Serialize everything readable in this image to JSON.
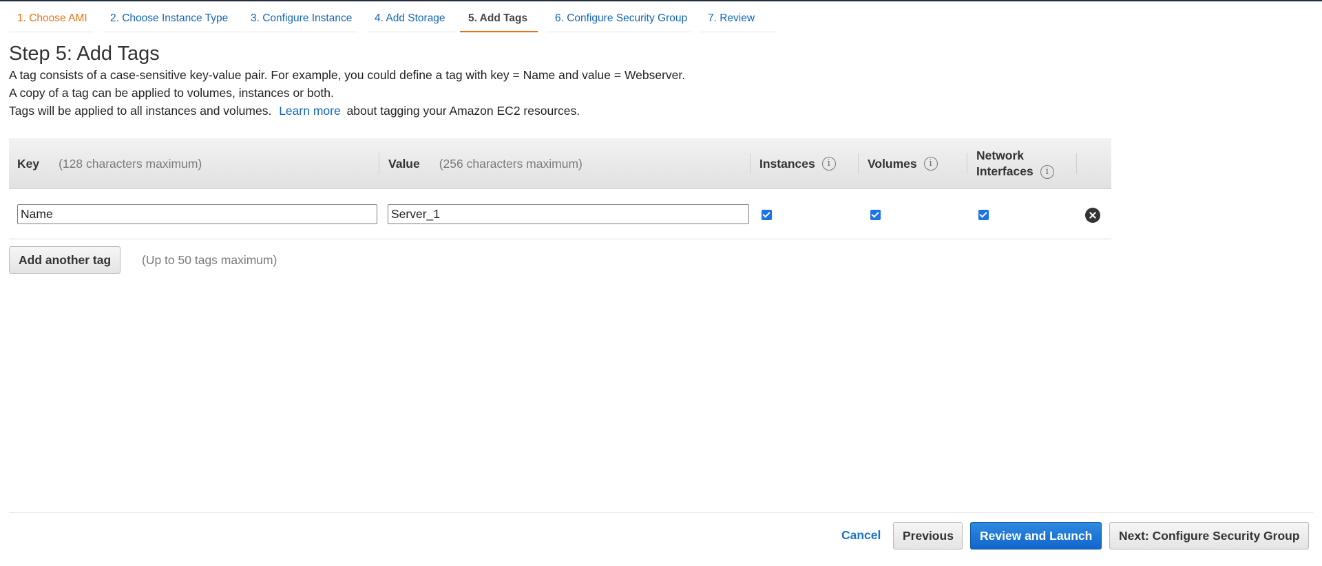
{
  "wizard": {
    "tabs": [
      {
        "label": "1. Choose AMI",
        "state": "done"
      },
      {
        "label": "2. Choose Instance Type",
        "state": "todo"
      },
      {
        "label": "3. Configure Instance",
        "state": "todo"
      },
      {
        "label": "4. Add Storage",
        "state": "todo"
      },
      {
        "label": "5. Add Tags",
        "state": "active"
      },
      {
        "label": "6. Configure Security Group",
        "state": "todo"
      },
      {
        "label": "7. Review",
        "state": "todo"
      }
    ]
  },
  "page": {
    "title": "Step 5: Add Tags",
    "line1": "A tag consists of a case-sensitive key-value pair. For example, you could define a tag with key = Name and value = Webserver.",
    "line2": "A copy of a tag can be applied to volumes, instances or both.",
    "line3_prefix": "Tags will be applied to all instances and volumes.",
    "learn_more": "Learn more",
    "line3_suffix": "about tagging your Amazon EC2 resources."
  },
  "table": {
    "headers": {
      "key": "Key",
      "key_hint": "(128 characters maximum)",
      "value": "Value",
      "value_hint": "(256 characters maximum)",
      "instances": "Instances",
      "volumes": "Volumes",
      "network_interfaces_1": "Network",
      "network_interfaces_2": "Interfaces"
    },
    "rows": [
      {
        "key": "Name",
        "value": "Server_1",
        "instances": true,
        "volumes": true,
        "network_interfaces": true
      }
    ]
  },
  "actions": {
    "add_tag": "Add another tag",
    "limit_note": "(Up to 50 tags maximum)",
    "cancel": "Cancel",
    "previous": "Previous",
    "review_launch": "Review and Launch",
    "next": "Next: Configure Security Group"
  },
  "colors": {
    "accent_orange": "#ec7211",
    "link_blue": "#1166bb",
    "primary_blue": "#1166cc"
  }
}
